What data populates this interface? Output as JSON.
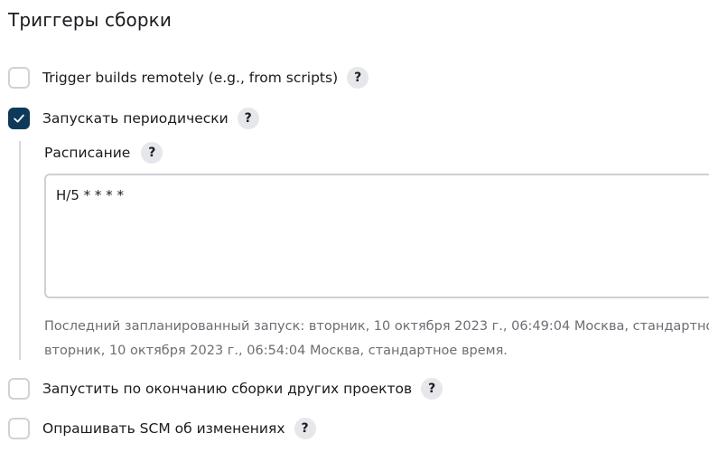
{
  "section": {
    "title": "Триггеры сборки"
  },
  "triggers": [
    {
      "label": "Trigger builds remotely (e.g., from scripts)",
      "checked": false,
      "help": "?"
    },
    {
      "label": "Запускать периодически",
      "checked": true,
      "help": "?"
    },
    {
      "label": "Запустить по окончанию сборки других проектов",
      "checked": false,
      "help": "?"
    },
    {
      "label": "Опрашивать SCM об изменениях",
      "checked": false,
      "help": "?"
    }
  ],
  "schedule": {
    "label": "Расписание",
    "help": "?",
    "value": "H/5 * * * *",
    "hint_line1": "Последний запланированный запуск: вторник, 10 октября 2023 г., 06:49:04 Москва, стандартное время; Следующий запуск:",
    "hint_line2": "вторник, 10 октября 2023 г., 06:54:04 Москва, стандартное время."
  },
  "colors": {
    "checkbox_checked": "#0e3a5a",
    "checkbox_border": "#cfd2d6",
    "help_bg": "#e6e7ea",
    "hint_text": "#6b6e73"
  },
  "icons": {
    "checkmark": "check-icon",
    "help": "question-mark-icon"
  }
}
